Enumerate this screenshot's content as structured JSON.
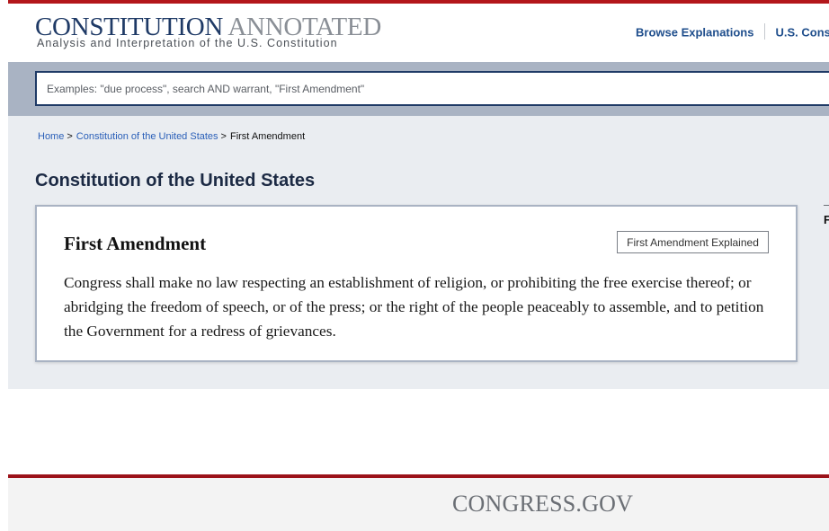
{
  "header": {
    "logo_primary": "CONSTITUTION",
    "logo_secondary": "ANNOTATED",
    "tagline": "Analysis and Interpretation of the U.S. Constitution",
    "nav": {
      "browse": "Browse Explanations",
      "constitution": "U.S. Cons"
    }
  },
  "search": {
    "placeholder": "Examples: \"due process\", search AND warrant, \"First Amendment\""
  },
  "breadcrumb": {
    "home": "Home",
    "constitution": "Constitution of the United States",
    "current": "First Amendment",
    "separator": ">"
  },
  "page": {
    "title": "Constitution of the United States"
  },
  "card": {
    "title": "First Amendment",
    "button": "First Amendment Explained",
    "text": "Congress shall make no law respecting an establishment of religion, or prohibiting the free exercise thereof; or abridging the freedom of speech, or of the press; or the right of the people peaceably to assemble, and to petition the Government for a redress of grievances."
  },
  "sidebar": {
    "letter": "F"
  },
  "footer": {
    "logo": "CONGRESS.GOV"
  },
  "colors": {
    "brand_red": "#b3161b",
    "brand_navy": "#1f3a66",
    "link_blue": "#2a5fb8",
    "search_band": "#a9b3c3",
    "content_bg": "#eaedf1"
  }
}
